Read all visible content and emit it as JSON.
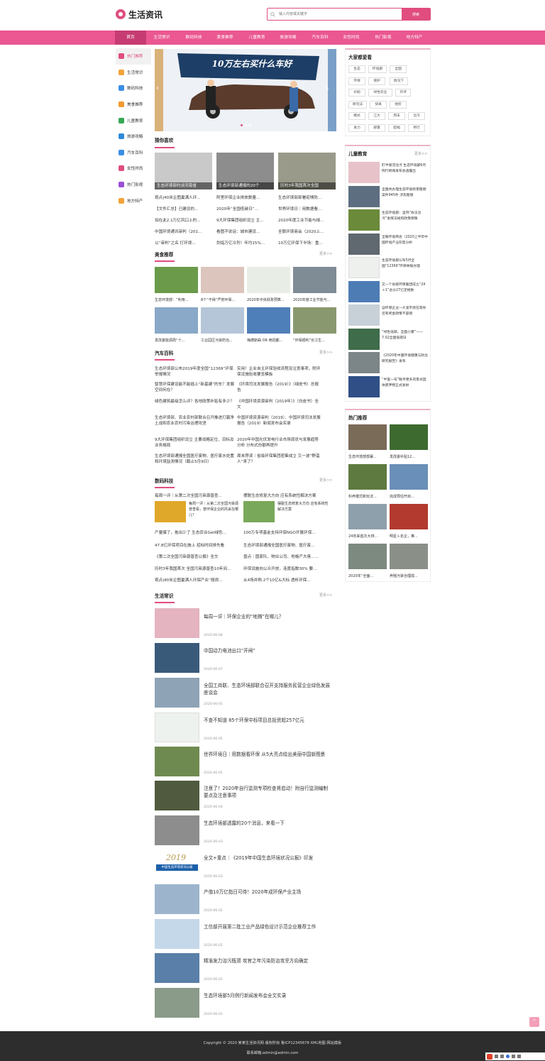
{
  "site": {
    "title": "生活资讯"
  },
  "search": {
    "placeholder": "输入内容或关键字",
    "button": "搜索"
  },
  "nav": [
    "首页",
    "生活常识",
    "数码科技",
    "美食推荐",
    "儿童教育",
    "旅游攻略",
    "汽车百科",
    "女性时尚",
    "热门影视",
    "地方特产"
  ],
  "sidebar": [
    {
      "label": "热门推荐",
      "color": "#e04d7e"
    },
    {
      "label": "生活常识",
      "color": "#f2a33a"
    },
    {
      "label": "数码科技",
      "color": "#3a8ee6"
    },
    {
      "label": "美食推荐",
      "color": "#f29a2e"
    },
    {
      "label": "儿童教育",
      "color": "#35a853"
    },
    {
      "label": "旅游攻略",
      "color": "#2f89d9"
    },
    {
      "label": "汽车百科",
      "color": "#3a8ee6"
    },
    {
      "label": "女性时尚",
      "color": "#e04d7e"
    },
    {
      "label": "热门影视",
      "color": "#9c4dd6"
    },
    {
      "label": "地方特产",
      "color": "#f2a33a"
    }
  ],
  "banner": {
    "text": "10万左右买什么车好"
  },
  "guess": {
    "title": "猜你喜欢",
    "cards": [
      "生态环境部约谈河南省",
      "生态环境部通报的20个",
      "历时3年我国首次全国"
    ],
    "rows": [
      [
        "观点|40米企图巢满人环...",
        "阿里环保企业排放数量...",
        "生态环境部部署疫情防..."
      ],
      [
        "【文件汇总】已建设的...",
        "2020年“全国低碳日”...",
        "世界环境日｜用数据看..."
      ],
      [
        "如在此2.1万亿风口上的...",
        "9大环保集团组织设立 主...",
        "2020年度工业节能与绿..."
      ],
      [
        "中国环境通讯审判（201...",
        "看图不说话：城市建设...",
        "全联环境商会（2020上..."
      ],
      [
        "以“审判”之名 打环境...",
        "剑指万亿冷剂！年均15%...",
        "10万亿环保下半场：重..."
      ]
    ]
  },
  "food": {
    "title": "美食推荐",
    "more": "更多>>",
    "items": [
      "生态环境部：“利用...",
      "8个“不得”严管环保...",
      "2020年中央财政预算...",
      "2020年度工业节能与...",
      "发改委能源局“十...",
      "工业园区污染防治...",
      "梅德斯曲 OR 绝招都...",
      "“环保顺利”长江生..."
    ]
  },
  "car": {
    "title": "汽车百科",
    "more": "更多>>",
    "left": [
      "生态环境部公布2019年度全国“12369”环保举报情况",
      "智慧环保建设能不能插上“新基建”的车？发展空间何在？",
      "绿色建筑最级怎么评？各地政策补贴有多少？",
      "生态环境部、农业农村部联合召开推进打赢净土战和农业农村污染治理攻坚",
      "9大环保集团组织设立 主要战略定位、目标及业务格局",
      "生态环境部通报全国医疗废物、医疗废水处置和环境监测情况（截止5月9日）"
    ],
    "right": [
      "实用！企业自主环保验收流程及注意事项，附环保设施验收要览模板",
      "《环境司法发展报告（2019）》（绿皮书）总报告",
      "《中国环境资源审判（2019年）》（白皮书）全文",
      "中国环境资源审判（2019）、中国环境司法发展报告（2019）新闻发布会实录",
      "2020年中国光伏发电行业市场现状与发展趋势分析 分布式份额再提升",
      "周末荐读｜省级环保集团密集成立 又一波“野蛮人”来了？"
    ]
  },
  "digital": {
    "title": "数码科技",
    "more": "更多>>",
    "top": [
      "每周一评｜从第二次全国污染源普查...",
      "摆脱生态修复大方向 应有系统性解决方案"
    ],
    "featured": [
      "每周一评｜从第二次全国污染源普查看，普环保企业的风采在哪儿？",
      "摆脱生态修复大方向 应有系统性解决方案"
    ],
    "left": [
      "产量爆了，拖出少了 生态农业Get绿色...",
      "47.8亿环保项目在施上 招标时间排先看",
      "《第二次全国污染源普查公报》全文",
      "历时3年我国首次 全国污染源普查10年间...",
      "观点|40米企图巢满人环保产业“翘浪..."
    ],
    "right": [
      "100万专项基金支持环保NGO开展环保...",
      "生态环境部通报全国医疗废物、医疗废...",
      "盘点｜国家队、物业公司、地格产大佬......",
      "环保设施向公众开放，连度指数30% 要...",
      "从4场并购 2个10亿&大标 透析环保..."
    ]
  },
  "life": {
    "title": "生活常识",
    "more": "更多>>",
    "items": [
      {
        "title": "每周一评｜环保企业的“地摊”在哪儿？",
        "date": "2020-06-08"
      },
      {
        "title": "中国动力电池出口“开闸”",
        "date": "2020-06-07"
      },
      {
        "title": "全国工商联、生态环境部联合召开支持服务民营企业绿色发展座谈会",
        "date": "2020-06-05"
      },
      {
        "title": "不查不知道 85个环保中标项目总投资超257亿元",
        "date": "2020-06-05"
      },
      {
        "title": "世界环境日｜用数据看环保 从5大亮点绘出美丽中国新图景",
        "date": "2020-06-05"
      },
      {
        "title": "注意了！2020年自行监测专项检查将启动！附自行监测编制要点及注意事项",
        "date": "2020-06-04"
      },
      {
        "title": "生态环境部透露的20个消息，来看一下",
        "date": "2020-06-03"
      },
      {
        "title": "全文+重点｜《2019年中国生态环境状况公报》印发",
        "date": "2020-06-03"
      },
      {
        "title": "产值10万亿指日可待！2020年成环保产业主场",
        "date": "2020-06-02"
      },
      {
        "title": "工信部开展第二批工业产品绿色设计示范企业推荐工作",
        "date": "2020-06-02"
      },
      {
        "title": "精准发力治污瓶颈 攻官之年污染防治攻坚方向确定",
        "date": "2020-06-02"
      },
      {
        "title": "生态环境部5月例行新闻发布会全文实录",
        "date": "2020-06-02"
      }
    ],
    "thumb_2019": {
      "year": "2019",
      "caption": "中国生态环境状况公报"
    }
  },
  "tags": {
    "title": "大家都爱看",
    "items": [
      "生态",
      "环境部",
      "全国",
      "环保",
      "保护",
      "情况下",
      "补助",
      "绿色农业",
      "开评",
      "新玩法",
      "快来",
      "组织",
      "模式",
      "江大",
      "周末",
      "治污",
      "发力",
      "部署",
      "超幅",
      "例行"
    ]
  },
  "kids": {
    "title": "儿童教育",
    "more": "更多>>",
    "items": [
      "盯半坡流治污 生态环境部6月例行新闻发布会透露出",
      "全国共办理生态环境损害赔偿案件945件 涉及赔偿",
      "生态环境部：坚持“依法治污”发挥法规和政策保障",
      "全联环境商会（2020上半年中国环境产业形势分析",
      "生态环境部公布5月全国“12369”环保举报办理",
      "又一个省级环保集团成立“24＋1”总分27亿定格数",
      "@环保企业一大波市场在等你 还有奖金政策不容错",
      "“绿色低碳，全面小康”——7.02全国低碳日",
      "《2020年中国环境健康与防治研究报告》发布",
      "“半宽一号”联手更多风景式固体废弃物正式发射"
    ]
  },
  "hot": {
    "title": "热门推荐",
    "items": [
      "生态环境部部署...",
      "发改委补贴12...",
      "科养模式新玩法...",
      "完成预估开启...",
      "24年来首次大排...",
      "明星＋名企，推...",
      "2020年“全面...",
      "养殖污染治理成..."
    ]
  },
  "footer": {
    "line1": "Copyright © 2020 某某生活资讯网 版权所有   鲁ICP12345678   XML地图   网站模板",
    "line2": "联系邮箱:admin@admin.com"
  }
}
